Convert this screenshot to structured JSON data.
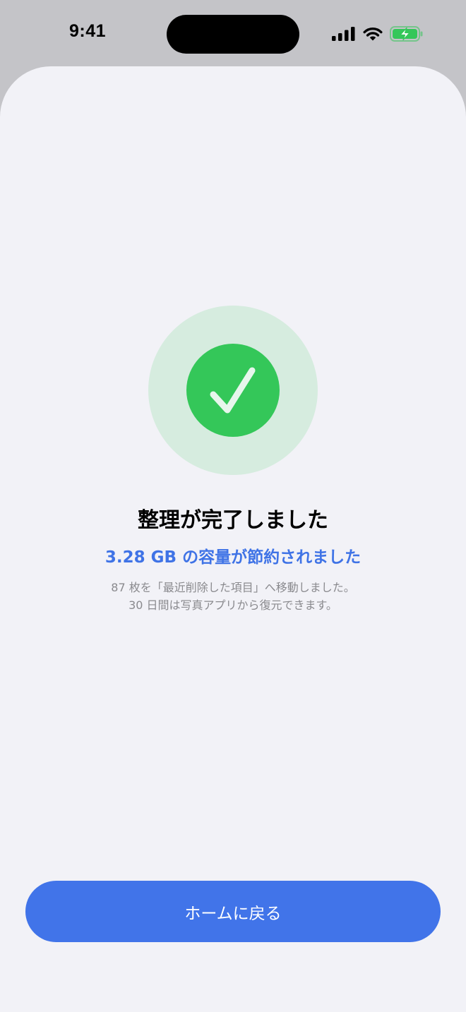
{
  "status_bar": {
    "time": "9:41",
    "icons": [
      "cellular-signal-icon",
      "wifi-icon",
      "battery-charging-icon"
    ],
    "battery_color": "#34c759"
  },
  "result": {
    "icon": "checkmark-icon",
    "accent_color": "#34c759",
    "title": "整理が完了しました",
    "saved_text": "3.28 GB の容量が節約されました",
    "description_line1": "87 枚を「最近削除した項目」へ移動しました。",
    "description_line2": "30 日間は写真アプリから復元できます。"
  },
  "actions": {
    "home_label": "ホームに戻る",
    "button_color": "#4174e9"
  }
}
